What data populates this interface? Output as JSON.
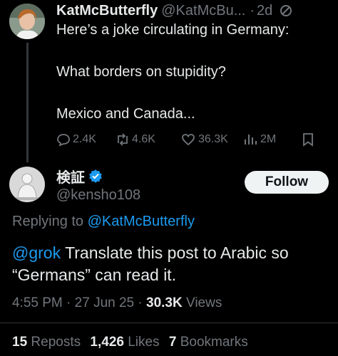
{
  "colors": {
    "background": "#000000",
    "text": "#e7e9ea",
    "muted": "#71767b",
    "link": "#1d9bf0",
    "verified": "#1d9bf0",
    "divider": "#2f3336"
  },
  "original_post": {
    "author_name": "KatMcButterfly",
    "author_handle": "@KatMcBu...",
    "separator": "·",
    "time": "2d",
    "line1": "Here’s a joke circulating in Germany:",
    "line2": "What borders on stupidity?",
    "line3": "Mexico and Canada...",
    "actions": {
      "replies": "2.4K",
      "reposts": "4.6K",
      "likes": "36.3K",
      "views": "2M"
    },
    "icons": {
      "badge": "slash-circle-icon",
      "reply": "comment-bubble-icon",
      "repost": "repost-arrows-icon",
      "like": "heart-icon",
      "views": "bar-chart-icon",
      "bookmark": "bookmark-icon"
    }
  },
  "reply_post": {
    "author_name": "検証",
    "author_handle": "@kensho108",
    "follow_label": "Follow",
    "replying_prefix": "Replying to",
    "replying_to": "@KatMcButterfly",
    "mention": "@grok",
    "text_line1": " Translate this post to Arabic so",
    "text_line2": "“Germans” can read it.",
    "time": "4:55 PM",
    "date": "27 Jun 25",
    "views_count": "30.3K",
    "views_label": "Views",
    "dot": "·",
    "icons": {
      "verified": "verified-badge-icon"
    }
  },
  "stats": {
    "reposts_count": "15",
    "reposts_label": "Reposts",
    "likes_count": "1,426",
    "likes_label": "Likes",
    "bookmarks_count": "7",
    "bookmarks_label": "Bookmarks"
  }
}
